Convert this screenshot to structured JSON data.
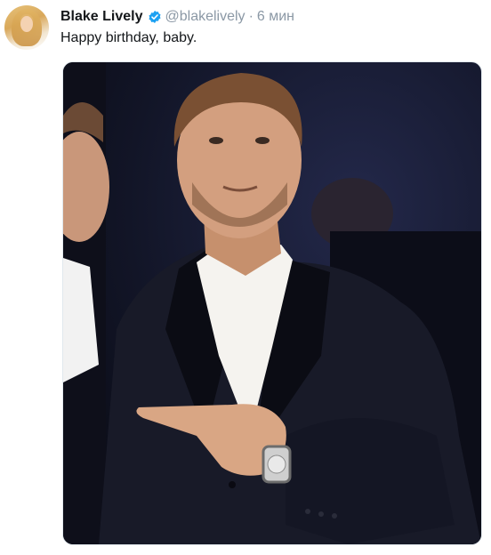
{
  "tweet": {
    "author_name": "Blake Lively",
    "author_handle": "@blakelively",
    "separator": "·",
    "time": "6 мин",
    "text": "Happy birthday, baby."
  },
  "icons": {
    "avatar": "user-avatar",
    "verified": "verified-badge-icon"
  },
  "colors": {
    "verified": "#1da1f2",
    "muted": "#8b98a5",
    "text": "#14171a"
  }
}
